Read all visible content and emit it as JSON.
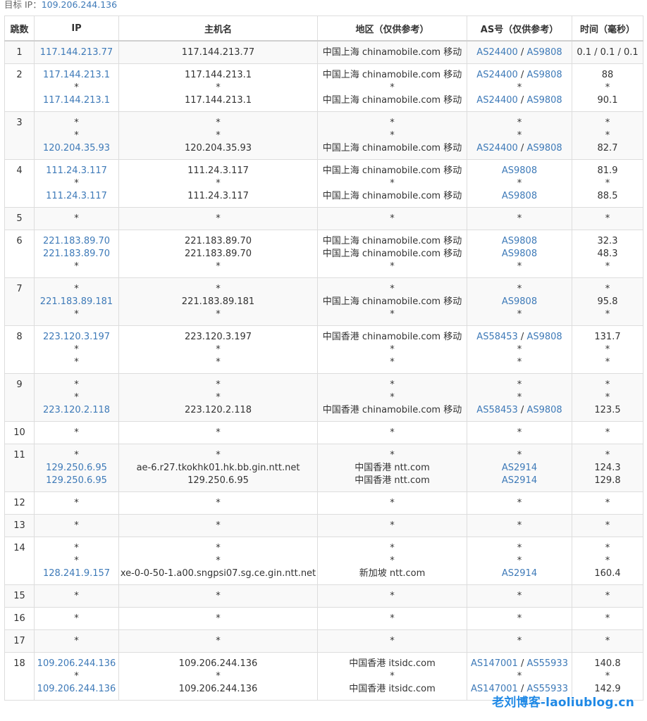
{
  "target": {
    "label": "目标 IP：",
    "ip": "109.206.244.136"
  },
  "headers": [
    "跳数",
    "IP",
    "主机名",
    "地区（仅供参考）",
    "AS号（仅供参考）",
    "时间（毫秒）"
  ],
  "hops": [
    {
      "n": "1",
      "lines": [
        {
          "ip": "117.144.213.77",
          "host": "117.144.213.77",
          "region": "中国上海 chinamobile.com 移动",
          "as": [
            "AS24400",
            "AS9808"
          ],
          "time": "0.1 / 0.1 / 0.1"
        }
      ]
    },
    {
      "n": "2",
      "lines": [
        {
          "ip": "117.144.213.1",
          "host": "117.144.213.1",
          "region": "中国上海 chinamobile.com 移动",
          "as": [
            "AS24400",
            "AS9808"
          ],
          "time": "88"
        },
        {
          "ip": "*",
          "host": "*",
          "region": "*",
          "as": [
            "*"
          ],
          "time": "*"
        },
        {
          "ip": "117.144.213.1",
          "host": "117.144.213.1",
          "region": "中国上海 chinamobile.com 移动",
          "as": [
            "AS24400",
            "AS9808"
          ],
          "time": "90.1"
        }
      ]
    },
    {
      "n": "3",
      "lines": [
        {
          "ip": "*",
          "host": "*",
          "region": "*",
          "as": [
            "*"
          ],
          "time": "*"
        },
        {
          "ip": "*",
          "host": "*",
          "region": "*",
          "as": [
            "*"
          ],
          "time": "*"
        },
        {
          "ip": "120.204.35.93",
          "host": "120.204.35.93",
          "region": "中国上海 chinamobile.com 移动",
          "as": [
            "AS24400",
            "AS9808"
          ],
          "time": "82.7"
        }
      ]
    },
    {
      "n": "4",
      "lines": [
        {
          "ip": "111.24.3.117",
          "host": "111.24.3.117",
          "region": "中国上海 chinamobile.com 移动",
          "as": [
            "AS9808"
          ],
          "time": "81.9"
        },
        {
          "ip": "*",
          "host": "*",
          "region": "*",
          "as": [
            "*"
          ],
          "time": "*"
        },
        {
          "ip": "111.24.3.117",
          "host": "111.24.3.117",
          "region": "中国上海 chinamobile.com 移动",
          "as": [
            "AS9808"
          ],
          "time": "88.5"
        }
      ]
    },
    {
      "n": "5",
      "lines": [
        {
          "ip": "*",
          "host": "*",
          "region": "*",
          "as": [
            "*"
          ],
          "time": "*"
        }
      ]
    },
    {
      "n": "6",
      "lines": [
        {
          "ip": "221.183.89.70",
          "host": "221.183.89.70",
          "region": "中国上海 chinamobile.com 移动",
          "as": [
            "AS9808"
          ],
          "time": "32.3"
        },
        {
          "ip": "221.183.89.70",
          "host": "221.183.89.70",
          "region": "中国上海 chinamobile.com 移动",
          "as": [
            "AS9808"
          ],
          "time": "48.3"
        },
        {
          "ip": "*",
          "host": "*",
          "region": "*",
          "as": [
            "*"
          ],
          "time": "*"
        }
      ]
    },
    {
      "n": "7",
      "lines": [
        {
          "ip": "*",
          "host": "*",
          "region": "*",
          "as": [
            "*"
          ],
          "time": "*"
        },
        {
          "ip": "221.183.89.181",
          "host": "221.183.89.181",
          "region": "中国上海 chinamobile.com 移动",
          "as": [
            "AS9808"
          ],
          "time": "95.8"
        },
        {
          "ip": "*",
          "host": "*",
          "region": "*",
          "as": [
            "*"
          ],
          "time": "*"
        }
      ]
    },
    {
      "n": "8",
      "lines": [
        {
          "ip": "223.120.3.197",
          "host": "223.120.3.197",
          "region": "中国香港 chinamobile.com 移动",
          "as": [
            "AS58453",
            "AS9808"
          ],
          "time": "131.7"
        },
        {
          "ip": "*",
          "host": "*",
          "region": "*",
          "as": [
            "*"
          ],
          "time": "*"
        },
        {
          "ip": "*",
          "host": "*",
          "region": "*",
          "as": [
            "*"
          ],
          "time": "*"
        }
      ]
    },
    {
      "n": "9",
      "lines": [
        {
          "ip": "*",
          "host": "*",
          "region": "*",
          "as": [
            "*"
          ],
          "time": "*"
        },
        {
          "ip": "*",
          "host": "*",
          "region": "*",
          "as": [
            "*"
          ],
          "time": "*"
        },
        {
          "ip": "223.120.2.118",
          "host": "223.120.2.118",
          "region": "中国香港 chinamobile.com 移动",
          "as": [
            "AS58453",
            "AS9808"
          ],
          "time": "123.5"
        }
      ]
    },
    {
      "n": "10",
      "lines": [
        {
          "ip": "*",
          "host": "*",
          "region": "*",
          "as": [
            "*"
          ],
          "time": "*"
        }
      ]
    },
    {
      "n": "11",
      "lines": [
        {
          "ip": "*",
          "host": "*",
          "region": "*",
          "as": [
            "*"
          ],
          "time": "*"
        },
        {
          "ip": "129.250.6.95",
          "host": "ae-6.r27.tkokhk01.hk.bb.gin.ntt.net",
          "region": "中国香港 ntt.com",
          "as": [
            "AS2914"
          ],
          "time": "124.3"
        },
        {
          "ip": "129.250.6.95",
          "host": "129.250.6.95",
          "region": "中国香港 ntt.com",
          "as": [
            "AS2914"
          ],
          "time": "129.8"
        }
      ]
    },
    {
      "n": "12",
      "lines": [
        {
          "ip": "*",
          "host": "*",
          "region": "*",
          "as": [
            "*"
          ],
          "time": "*"
        }
      ]
    },
    {
      "n": "13",
      "lines": [
        {
          "ip": "*",
          "host": "*",
          "region": "*",
          "as": [
            "*"
          ],
          "time": "*"
        }
      ]
    },
    {
      "n": "14",
      "lines": [
        {
          "ip": "*",
          "host": "*",
          "region": "*",
          "as": [
            "*"
          ],
          "time": "*"
        },
        {
          "ip": "*",
          "host": "*",
          "region": "*",
          "as": [
            "*"
          ],
          "time": "*"
        },
        {
          "ip": "128.241.9.157",
          "host": "xe-0-0-50-1.a00.sngpsi07.sg.ce.gin.ntt.net",
          "region": "新加坡 ntt.com",
          "as": [
            "AS2914"
          ],
          "time": "160.4"
        }
      ]
    },
    {
      "n": "15",
      "lines": [
        {
          "ip": "*",
          "host": "*",
          "region": "*",
          "as": [
            "*"
          ],
          "time": "*"
        }
      ]
    },
    {
      "n": "16",
      "lines": [
        {
          "ip": "*",
          "host": "*",
          "region": "*",
          "as": [
            "*"
          ],
          "time": "*"
        }
      ]
    },
    {
      "n": "17",
      "lines": [
        {
          "ip": "*",
          "host": "*",
          "region": "*",
          "as": [
            "*"
          ],
          "time": "*"
        }
      ]
    },
    {
      "n": "18",
      "lines": [
        {
          "ip": "109.206.244.136",
          "host": "109.206.244.136",
          "region": "中国香港 itsidc.com",
          "as": [
            "AS147001",
            "AS55933"
          ],
          "time": "140.8"
        },
        {
          "ip": "*",
          "host": "*",
          "region": "*",
          "as": [
            "*"
          ],
          "time": "*"
        },
        {
          "ip": "109.206.244.136",
          "host": "109.206.244.136",
          "region": "中国香港 itsidc.com",
          "as": [
            "AS147001",
            "AS55933"
          ],
          "time": "142.9"
        }
      ]
    }
  ],
  "watermark": "老刘博客-laoliublog.cn",
  "colors": {
    "link": "#3e7ab8",
    "text": "#333333",
    "stripe": "#f9f9f9",
    "border": "#dddddd",
    "watermark": "#1e88e5"
  }
}
